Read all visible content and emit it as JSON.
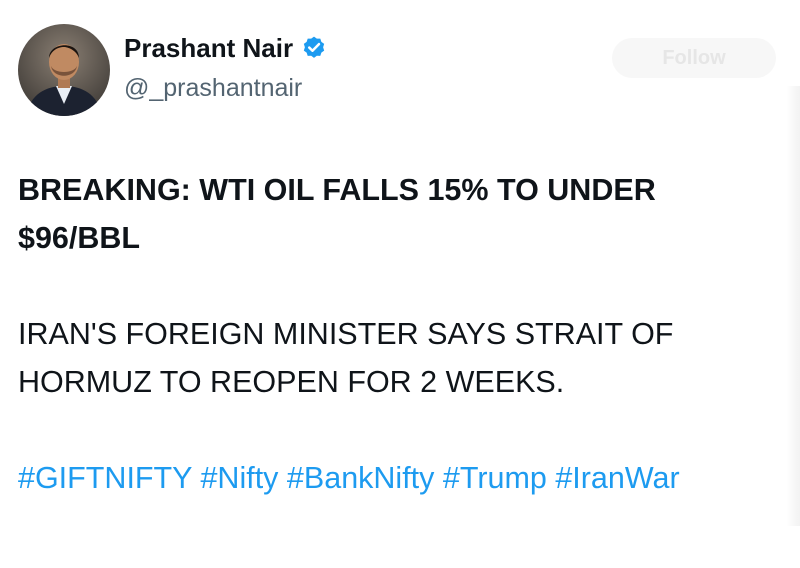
{
  "author": {
    "display_name": "Prashant Nair",
    "handle": "@_prashantnair",
    "verified": true,
    "avatar_icon": "profile-photo"
  },
  "follow_button_label": "Follow",
  "tweet": {
    "headline": "BREAKING: WTI OIL FALLS 15% TO UNDER\n$96/BBL",
    "subtext": "IRAN'S FOREIGN MINISTER SAYS STRAIT OF\nHORMUZ TO REOPEN FOR 2 WEEKS.",
    "hashtags": [
      "#GIFTNIFTY",
      "#Nifty",
      "#BankNifty",
      "#Trump",
      "#IranWar"
    ]
  },
  "colors": {
    "text": "#0f1419",
    "handle": "#536471",
    "link": "#1d9bf0",
    "verified_badge": "#1d9bf0"
  }
}
